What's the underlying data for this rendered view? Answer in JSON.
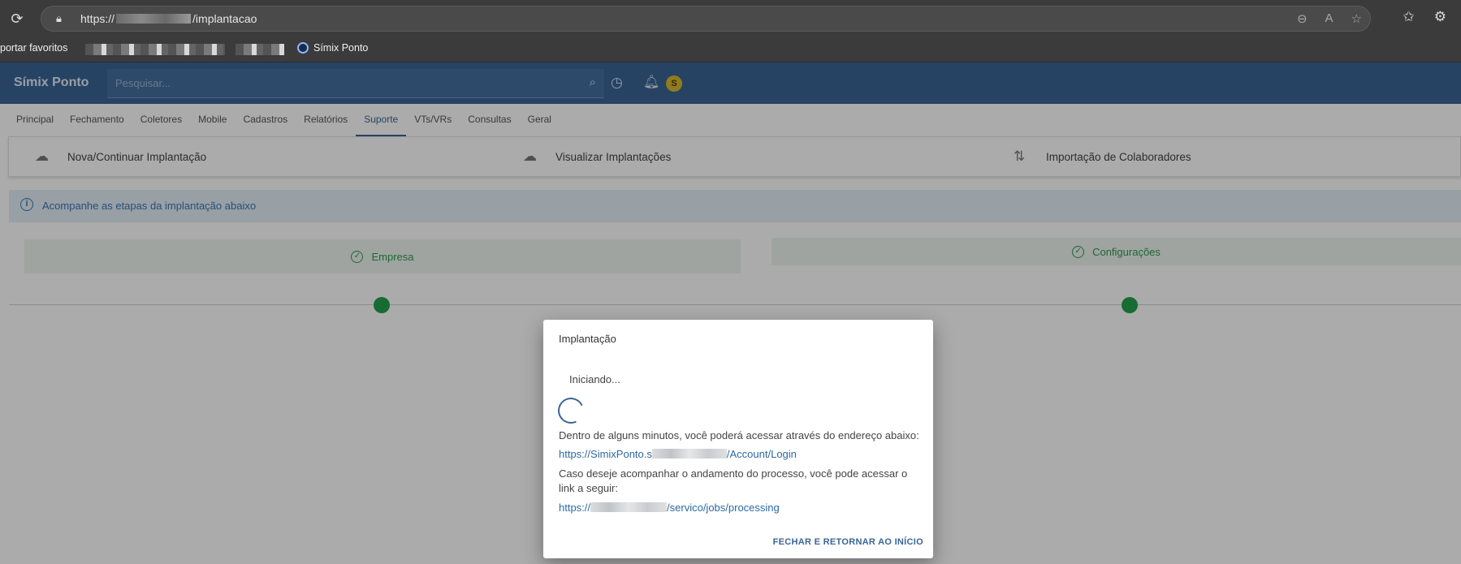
{
  "browser": {
    "url_prefix": "https://",
    "url_suffix": "/implantacao",
    "favorites": {
      "import_label": "portar favoritos",
      "bookmark_label": "Símix Ponto"
    }
  },
  "header": {
    "brand": "Símix Ponto",
    "search_placeholder": "Pesquisar...",
    "avatar_initial": "S"
  },
  "nav": {
    "tabs": [
      "Principal",
      "Fechamento",
      "Coletores",
      "Mobile",
      "Cadastros",
      "Relatórios",
      "Suporte",
      "VTs/VRs",
      "Consultas",
      "Geral"
    ],
    "active_tab": "Suporte"
  },
  "subbar": {
    "items": [
      "Nova/Continuar Implantação",
      "Visualizar Implantações",
      "Importação de Colaboradores"
    ]
  },
  "info": {
    "text": "Acompanhe as etapas da implantação abaixo"
  },
  "steps": [
    {
      "label": "Empresa",
      "status": "done"
    },
    {
      "label": "Configurações",
      "status": "done"
    }
  ],
  "dialog": {
    "title": "Implantação",
    "status": "Iniciando...",
    "message1": "Dentro de alguns minutos, você poderá acessar através do endereço abaixo:",
    "link1_prefix": "https://SimixPonto.s",
    "link1_suffix": "/Account/Login",
    "message2": "Caso deseje acompanhar o andamento do processo, você pode acessar o link a seguir:",
    "link2_prefix": "https://",
    "link2_suffix": "/servico/jobs/processing",
    "close_button": "FECHAR E RETORNAR AO INÍCIO"
  },
  "colors": {
    "primary": "#3a6596",
    "success": "#22a24d",
    "info": "#3a78b5"
  }
}
